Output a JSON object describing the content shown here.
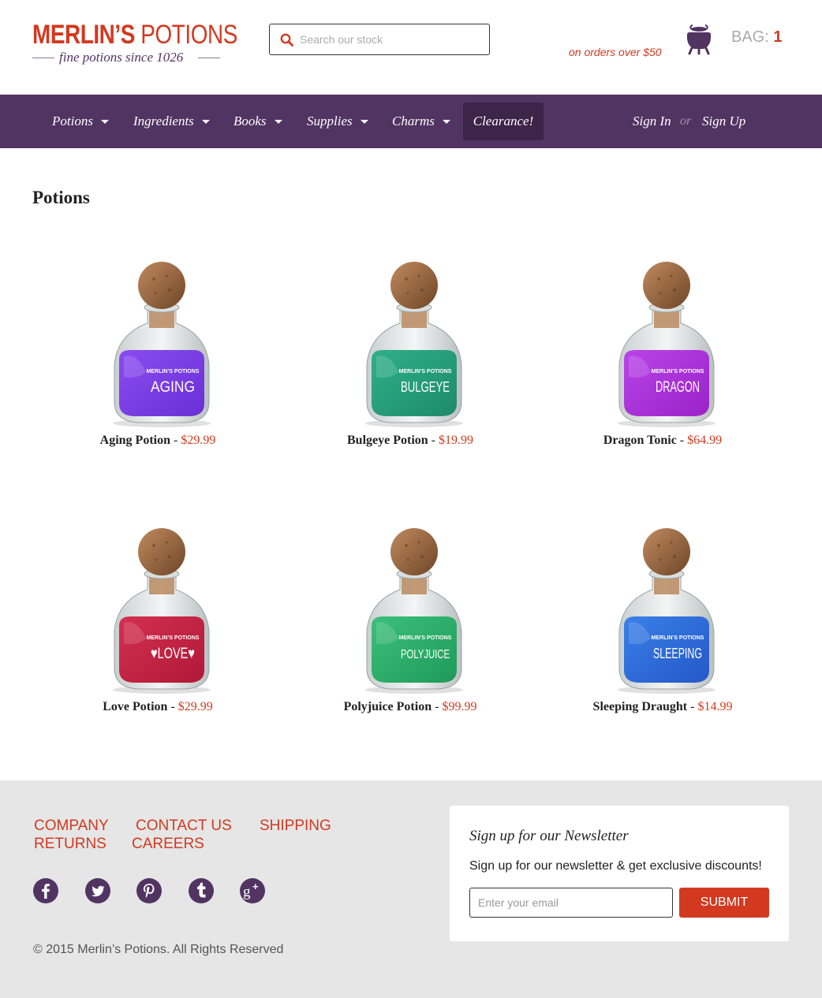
{
  "brand": {
    "name_bold": "MERLIN’S",
    "name_light": "POTIONS",
    "tagline": "fine potions since 1026"
  },
  "search": {
    "placeholder": "Search our stock"
  },
  "header": {
    "promo": "on orders over $50",
    "bag_label": "BAG:",
    "bag_count": "1"
  },
  "nav": {
    "items": [
      {
        "label": "Potions"
      },
      {
        "label": "Ingredients"
      },
      {
        "label": "Books"
      },
      {
        "label": "Supplies"
      },
      {
        "label": "Charms"
      }
    ],
    "clearance": "Clearance!",
    "sign_in": "Sign In",
    "or": "or",
    "sign_up": "Sign Up"
  },
  "main": {
    "title": "Potions",
    "products": [
      {
        "name": "Aging Potion",
        "sep": " - ",
        "price": "$29.99",
        "label": "AGING",
        "color": "#6a2fd6",
        "color2": "#8a4cf0"
      },
      {
        "name": "Bulgeye Potion",
        "sep": " - ",
        "price": "$19.99",
        "label": "BULGEYE",
        "color": "#1e8a6a",
        "color2": "#2fb08a"
      },
      {
        "name": "Dragon Tonic",
        "sep": " - ",
        "price": "$64.99",
        "label": "DRAGON",
        "color": "#9a22c8",
        "color2": "#b845e8"
      },
      {
        "name": "Love Potion",
        "sep": " - ",
        "price": "$29.99",
        "label": "♥LOVE♥",
        "color": "#b01838",
        "color2": "#d4304f"
      },
      {
        "name": "Polyjuice Potion",
        "sep": " - ",
        "price": "$99.99",
        "label": "POLYJUICE",
        "color": "#1e9a5a",
        "color2": "#3cc07a"
      },
      {
        "name": "Sleeping Draught",
        "sep": " - ",
        "price": "$14.99",
        "label": "SLEEPING",
        "color": "#2458c8",
        "color2": "#3a80e8"
      }
    ],
    "bottle_brand": "MERLIN’S POTIONS"
  },
  "footer": {
    "links": [
      {
        "label": "COMPANY"
      },
      {
        "label": "CONTACT US"
      },
      {
        "label": "SHIPPING"
      },
      {
        "label": "RETURNS"
      },
      {
        "label": "CAREERS"
      }
    ],
    "social": [
      "facebook-icon",
      "twitter-icon",
      "pinterest-icon",
      "tumblr-icon",
      "google-plus-icon"
    ],
    "copyright": "© 2015 Merlin’s Potions. All Rights Reserved",
    "newsletter": {
      "title": "Sign up for our Newsletter",
      "text": "Sign up for our newsletter & get exclusive discounts!",
      "email_placeholder": "Enter your email",
      "submit": "SUBMIT"
    }
  },
  "colors": {
    "accent": "#d3391f",
    "purple": "#513462",
    "footer_bg": "#e6e6e6"
  }
}
